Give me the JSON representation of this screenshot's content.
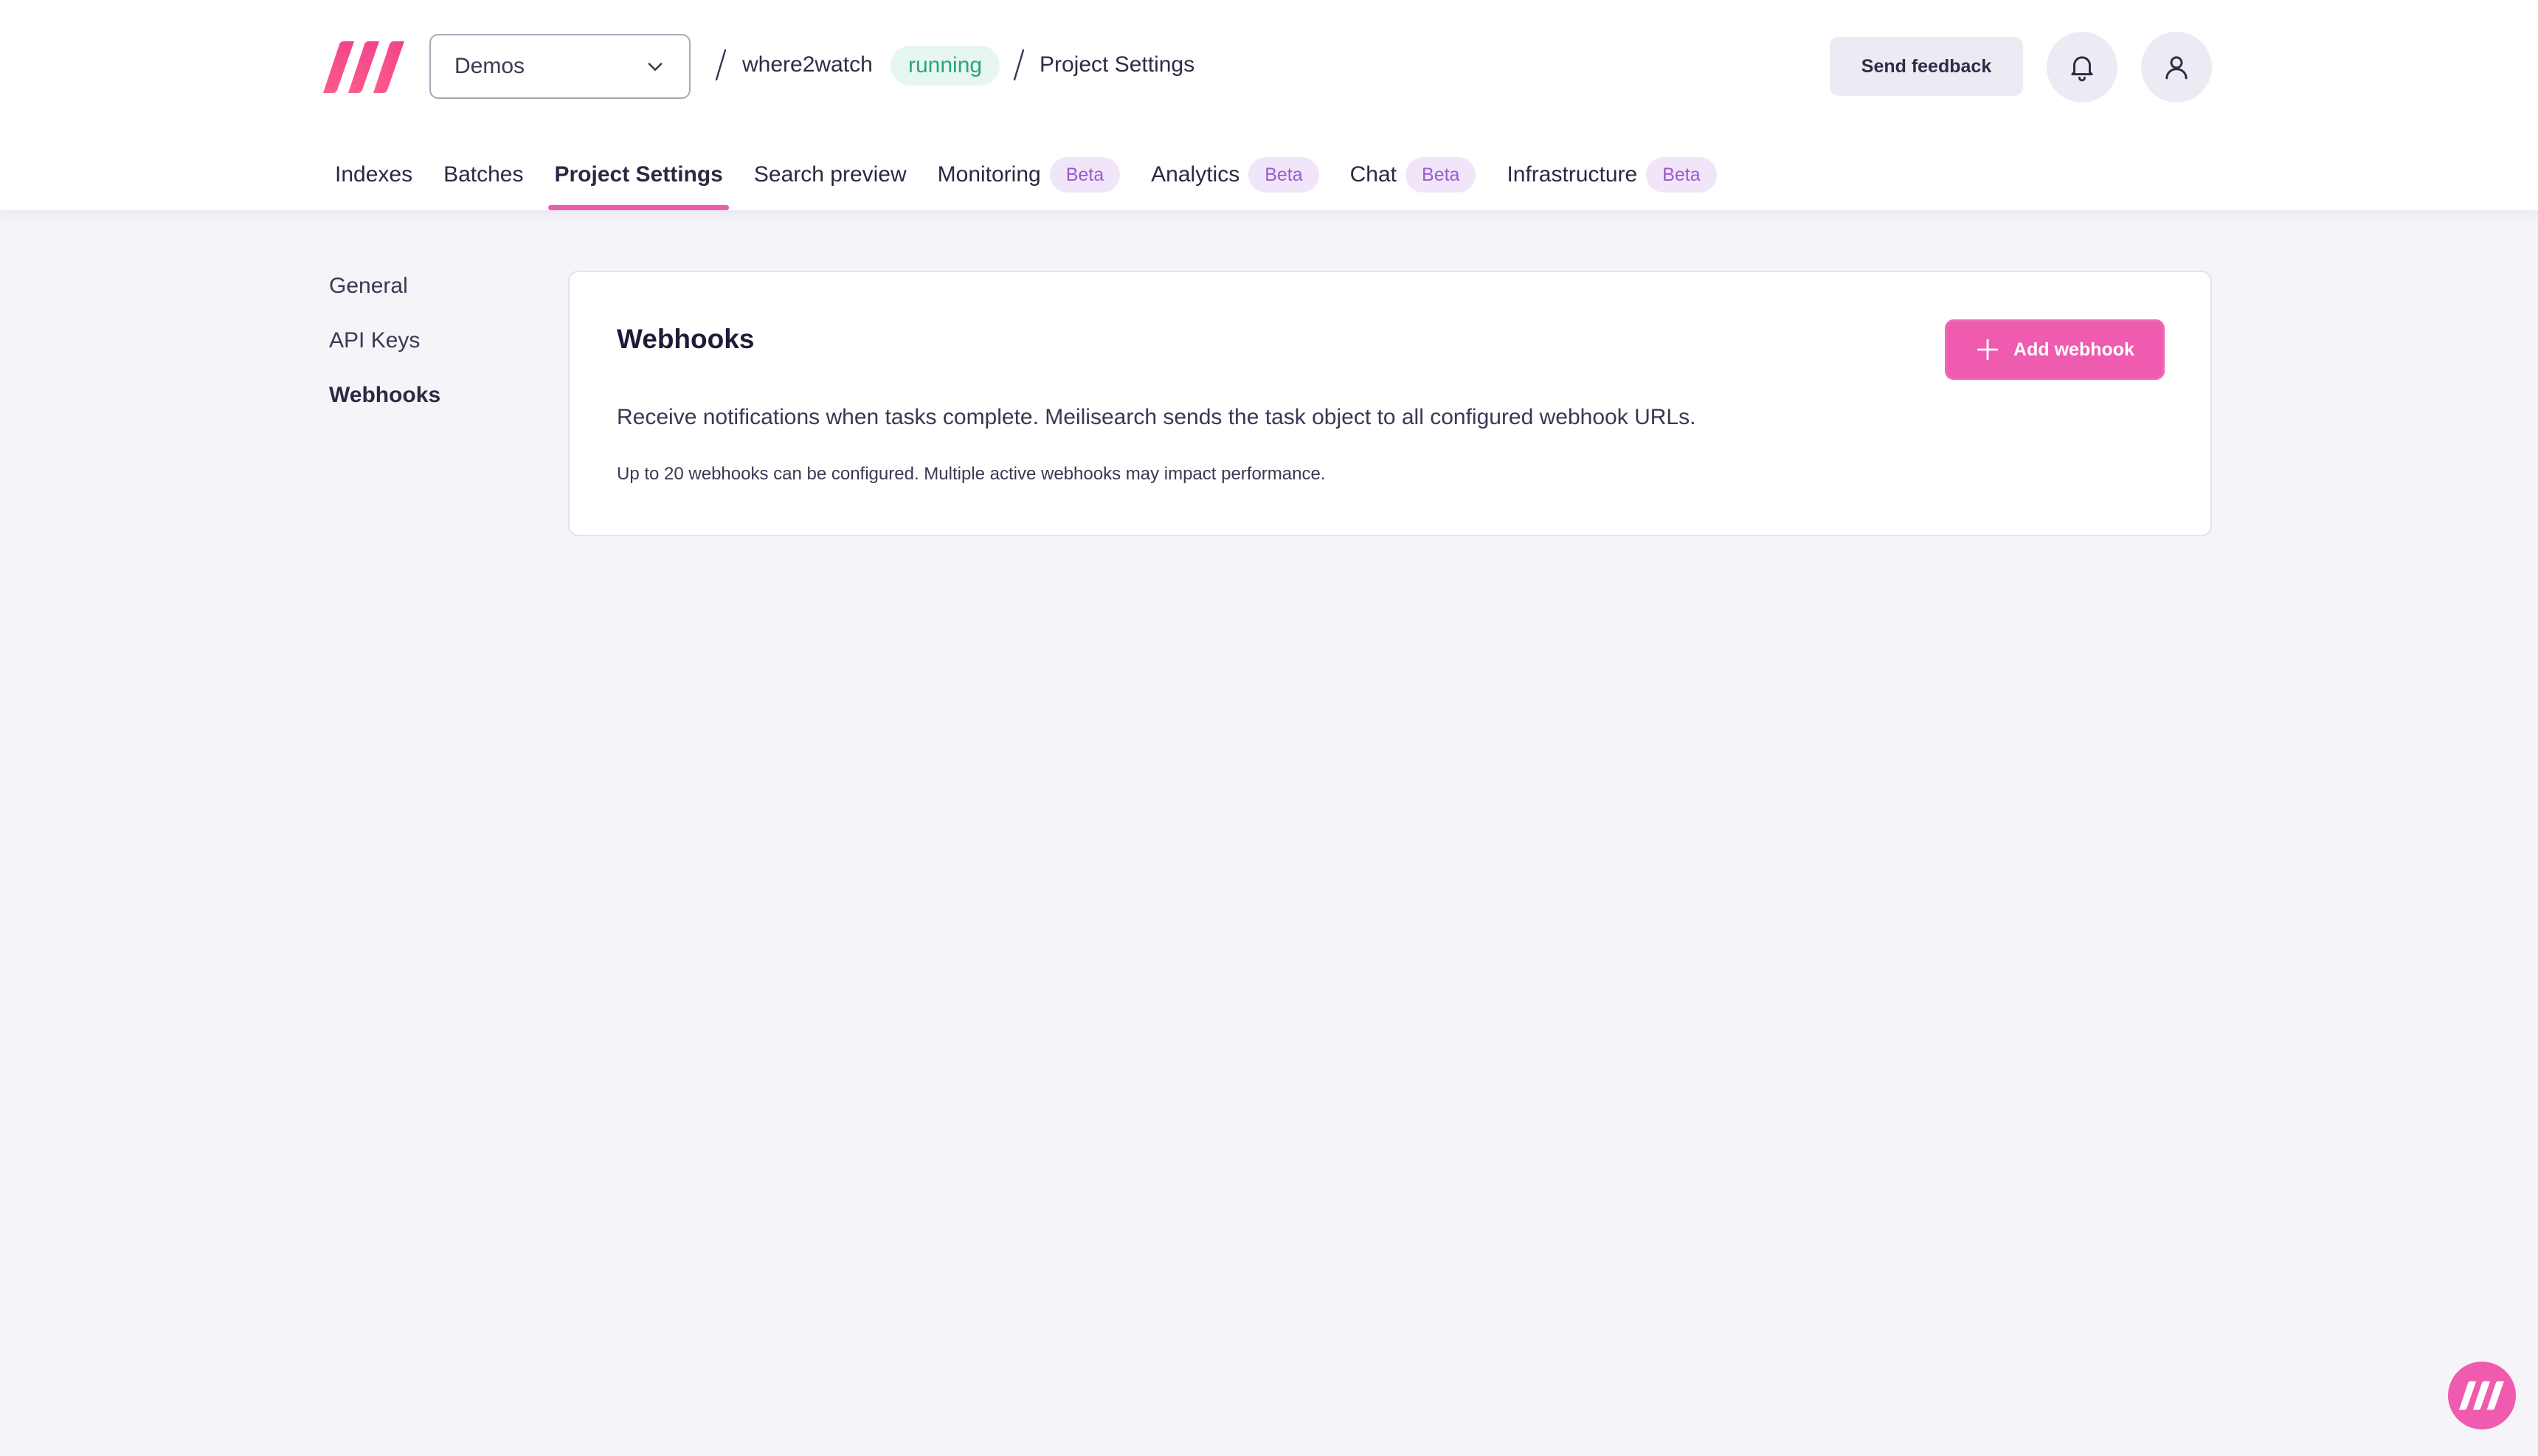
{
  "brand": {
    "logo_icon": "meilisearch-logo-icon",
    "accent_color": "#ef5bae"
  },
  "header": {
    "project_select": {
      "value": "Demos",
      "icon": "chevron-down-icon"
    },
    "breadcrumb": {
      "separator": "/",
      "project": "where2watch",
      "status": "running",
      "page": "Project Settings"
    },
    "feedback_label": "Send feedback",
    "notifications_icon": "bell-icon",
    "account_icon": "user-icon"
  },
  "tabs": [
    {
      "label": "Indexes",
      "badge": null,
      "active": false
    },
    {
      "label": "Batches",
      "badge": null,
      "active": false
    },
    {
      "label": "Project Settings",
      "badge": null,
      "active": true
    },
    {
      "label": "Search preview",
      "badge": null,
      "active": false
    },
    {
      "label": "Monitoring",
      "badge": "Beta",
      "active": false
    },
    {
      "label": "Analytics",
      "badge": "Beta",
      "active": false
    },
    {
      "label": "Chat",
      "badge": "Beta",
      "active": false
    },
    {
      "label": "Infrastructure",
      "badge": "Beta",
      "active": false
    }
  ],
  "sidenav": {
    "items": [
      {
        "label": "General",
        "active": false
      },
      {
        "label": "API Keys",
        "active": false
      },
      {
        "label": "Webhooks",
        "active": true
      }
    ]
  },
  "webhooks": {
    "title": "Webhooks",
    "add_button_label": "Add webhook",
    "add_button_icon": "plus-icon",
    "description": "Receive notifications when tasks complete. Meilisearch sends the task object to all configured webhook URLs.",
    "note": "Up to 20 webhooks can be configured. Multiple active webhooks may impact performance."
  },
  "help_widget": {
    "icon": "meilisearch-logo-icon"
  }
}
